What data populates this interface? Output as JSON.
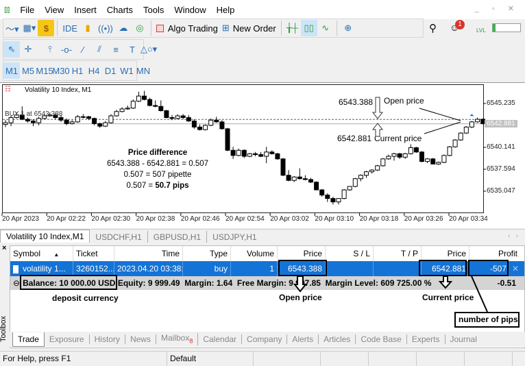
{
  "menu": {
    "items": [
      "File",
      "View",
      "Insert",
      "Charts",
      "Tools",
      "Window",
      "Help"
    ]
  },
  "toolbar": {
    "ide": "IDE",
    "algo_trading": "Algo Trading",
    "new_order": "New Order",
    "notification_count": "1",
    "level_label": "LVL"
  },
  "timeframes": [
    "M1",
    "M5",
    "M15",
    "M30",
    "H1",
    "H4",
    "D1",
    "W1",
    "MN"
  ],
  "timeframe_selected": "M1",
  "chart": {
    "title": "Volatility 10 Index, M1",
    "bid_label": "BUY 1 at 6543.388",
    "current_price_label": "6542.881",
    "annotations": {
      "open_value": "6543.388",
      "open_label": "Open price",
      "current_value": "6542.881",
      "current_label": "Current price",
      "diff_title": "Price difference",
      "diff_line1": "6543.388 - 6542.881 = 0.507",
      "diff_line2": "0.507 = 507 pipette",
      "diff_line3a": "0.507 = ",
      "diff_line3b": "50.7 pips"
    }
  },
  "chart_data": {
    "type": "candlestick",
    "title": "Volatility 10 Index, M1",
    "x_tick_labels": [
      "20 Apr 2023",
      "20 Apr 02:22",
      "20 Apr 02:30",
      "20 Apr 02:38",
      "20 Apr 02:46",
      "20 Apr 02:54",
      "20 Apr 03:02",
      "20 Apr 03:10",
      "20 Apr 03:18",
      "20 Apr 03:26",
      "20 Apr 03:34"
    ],
    "y_tick_labels": [
      "6545.235",
      "6540.141",
      "6537.594",
      "6535.047"
    ],
    "y_ticks": [
      6545.235,
      6540.141,
      6537.594,
      6535.047
    ],
    "ylim": [
      6532.9,
      6547.6
    ],
    "open_price_line": 6543.388,
    "current_price_line": 6542.881,
    "candles_ohlc": [
      [
        6542.8,
        6543.3,
        6542.5,
        6543.0
      ],
      [
        6543.0,
        6543.8,
        6542.6,
        6543.6
      ],
      [
        6543.6,
        6544.2,
        6543.5,
        6543.9
      ],
      [
        6543.9,
        6544.9,
        6543.3,
        6543.4
      ],
      [
        6543.4,
        6543.6,
        6543.0,
        6543.2
      ],
      [
        6543.2,
        6543.4,
        6542.6,
        6543.0
      ],
      [
        6543.0,
        6543.7,
        6542.7,
        6543.5
      ],
      [
        6543.5,
        6544.0,
        6543.4,
        6543.8
      ],
      [
        6543.8,
        6544.2,
        6543.7,
        6543.9
      ],
      [
        6543.9,
        6544.1,
        6543.4,
        6543.6
      ],
      [
        6543.6,
        6543.9,
        6543.1,
        6543.3
      ],
      [
        6543.3,
        6543.5,
        6542.7,
        6542.9
      ],
      [
        6542.9,
        6543.3,
        6542.8,
        6543.1
      ],
      [
        6543.1,
        6543.9,
        6543.0,
        6543.7
      ],
      [
        6543.7,
        6544.0,
        6543.5,
        6543.7
      ],
      [
        6543.7,
        6543.8,
        6543.3,
        6543.5
      ],
      [
        6543.5,
        6543.6,
        6542.7,
        6542.9
      ],
      [
        6542.9,
        6543.0,
        6542.4,
        6542.6
      ],
      [
        6542.6,
        6543.2,
        6542.5,
        6543.0
      ],
      [
        6543.0,
        6544.0,
        6542.9,
        6543.8
      ],
      [
        6543.8,
        6544.5,
        6543.7,
        6544.3
      ],
      [
        6544.3,
        6544.8,
        6544.2,
        6544.6
      ],
      [
        6544.6,
        6545.0,
        6544.5,
        6544.7
      ],
      [
        6544.7,
        6545.7,
        6544.6,
        6545.5
      ],
      [
        6545.5,
        6546.6,
        6545.4,
        6546.1
      ],
      [
        6546.1,
        6546.7,
        6545.6,
        6545.7
      ],
      [
        6545.7,
        6545.9,
        6544.9,
        6545.0
      ],
      [
        6545.0,
        6545.6,
        6544.8,
        6544.9
      ],
      [
        6544.9,
        6545.6,
        6544.3,
        6544.4
      ],
      [
        6544.4,
        6544.5,
        6543.5,
        6543.6
      ],
      [
        6543.6,
        6543.9,
        6543.3,
        6543.5
      ],
      [
        6543.5,
        6544.0,
        6543.4,
        6543.8
      ],
      [
        6543.8,
        6544.0,
        6543.4,
        6543.6
      ],
      [
        6543.6,
        6543.9,
        6543.1,
        6543.2
      ],
      [
        6543.2,
        6543.4,
        6542.3,
        6542.5
      ],
      [
        6542.5,
        6542.8,
        6542.1,
        6542.2
      ],
      [
        6542.2,
        6542.8,
        6542.1,
        6542.7
      ],
      [
        6542.7,
        6543.5,
        6542.6,
        6543.3
      ],
      [
        6543.3,
        6543.7,
        6543.0,
        6543.1
      ],
      [
        6543.1,
        6543.3,
        6542.2,
        6542.3
      ],
      [
        6542.3,
        6542.4,
        6539.7,
        6539.8
      ],
      [
        6539.8,
        6540.2,
        6538.8,
        6539.2
      ],
      [
        6539.2,
        6540.0,
        6539.1,
        6539.8
      ],
      [
        6539.8,
        6539.9,
        6538.9,
        6539.1
      ],
      [
        6539.1,
        6539.5,
        6539.0,
        6539.4
      ],
      [
        6539.4,
        6539.6,
        6539.1,
        6539.3
      ],
      [
        6539.3,
        6539.6,
        6539.0,
        6539.1
      ],
      [
        6539.1,
        6540.2,
        6538.3,
        6539.6
      ],
      [
        6539.6,
        6539.8,
        6539.3,
        6539.4
      ],
      [
        6539.4,
        6539.5,
        6538.7,
        6538.8
      ],
      [
        6538.8,
        6538.9,
        6536.8,
        6536.9
      ],
      [
        6536.9,
        6537.5,
        6536.2,
        6536.3
      ],
      [
        6536.3,
        6536.8,
        6536.1,
        6536.7
      ],
      [
        6536.7,
        6537.7,
        6536.4,
        6536.5
      ],
      [
        6536.5,
        6536.9,
        6536.3,
        6536.4
      ],
      [
        6536.4,
        6536.6,
        6536.0,
        6536.1
      ],
      [
        6536.1,
        6536.2,
        6535.2,
        6535.2
      ],
      [
        6535.2,
        6535.3,
        6534.4,
        6534.6
      ],
      [
        6534.6,
        6534.8,
        6533.8,
        6534.2
      ],
      [
        6534.2,
        6534.4,
        6533.5,
        6533.8
      ],
      [
        6533.8,
        6534.2,
        6533.5,
        6534.2
      ],
      [
        6534.2,
        6535.3,
        6534.1,
        6535.2
      ],
      [
        6535.2,
        6535.6,
        6535.1,
        6535.6
      ],
      [
        6535.6,
        6536.6,
        6535.5,
        6536.5
      ],
      [
        6536.5,
        6537.0,
        6536.2,
        6536.9
      ],
      [
        6536.9,
        6537.4,
        6536.6,
        6537.3
      ],
      [
        6537.3,
        6537.6,
        6537.1,
        6537.5
      ],
      [
        6537.5,
        6538.1,
        6537.4,
        6538.0
      ],
      [
        6538.0,
        6538.9,
        6537.9,
        6538.8
      ],
      [
        6538.8,
        6539.3,
        6538.7,
        6539.1
      ],
      [
        6539.1,
        6539.5,
        6538.6,
        6539.4
      ],
      [
        6539.4,
        6539.5,
        6538.8,
        6539.0
      ],
      [
        6539.0,
        6539.5,
        6538.8,
        6539.4
      ],
      [
        6539.4,
        6540.5,
        6539.3,
        6540.1
      ],
      [
        6540.1,
        6540.2,
        6539.5,
        6539.6
      ],
      [
        6539.6,
        6539.7,
        6538.4,
        6538.5
      ],
      [
        6538.5,
        6538.9,
        6538.3,
        6538.8
      ],
      [
        6538.8,
        6538.9,
        6538.2,
        6538.2
      ],
      [
        6538.2,
        6538.5,
        6538.1,
        6538.4
      ],
      [
        6538.4,
        6539.3,
        6538.3,
        6539.2
      ],
      [
        6539.2,
        6540.3,
        6539.1,
        6540.2
      ],
      [
        6540.2,
        6541.1,
        6540.1,
        6541.0
      ],
      [
        6541.0,
        6541.9,
        6540.9,
        6541.8
      ],
      [
        6541.8,
        6542.6,
        6541.7,
        6542.5
      ],
      [
        6542.5,
        6543.2,
        6542.4,
        6543.1
      ],
      [
        6543.1,
        6543.6,
        6543.0,
        6543.4
      ],
      [
        6543.4,
        6543.5,
        6542.8,
        6542.9
      ]
    ]
  },
  "chart_tabs": [
    "Volatility 10 Index,M1",
    "USDCHF,H1",
    "GBPUSD,H1",
    "USDJPY,H1"
  ],
  "trade": {
    "columns": [
      "Symbol",
      "Ticket",
      "Time",
      "Type",
      "Volume",
      "Price",
      "S / L",
      "T / P",
      "Price",
      "Profit"
    ],
    "row": {
      "symbol": "volatility 1...",
      "ticket": "3260152...",
      "time": "2023.04.20 03:38:...",
      "type": "buy",
      "volume": "1",
      "open_price": "6543.388",
      "sl": "",
      "tp": "",
      "current_price": "6542.881",
      "profit": "-507"
    },
    "balance": {
      "balance": "Balance: 10 000.00 USD",
      "equity": "Equity: 9 999.49",
      "margin": "Margin: 1.64",
      "free_margin": "Free Margin: 9 997.85",
      "margin_level": "Margin Level: 609 725.00 %",
      "profit": "-0.51"
    },
    "annotations": {
      "deposit": "deposit currency",
      "open": "Open price",
      "current": "Current price",
      "pips": "number of pips"
    }
  },
  "toolbox_label": "Toolbox",
  "bottom_tabs": [
    "Trade",
    "Exposure",
    "History",
    "News",
    "Mailbox",
    "Calendar",
    "Company",
    "Alerts",
    "Articles",
    "Code Base",
    "Experts",
    "Journal"
  ],
  "mailbox_count": "8",
  "status": {
    "help": "For Help, press F1",
    "profile": "Default"
  },
  "colors": {
    "selected_row": "#1473d6",
    "bull": "#ffffff",
    "bear": "#000000",
    "open_line": "#2e7d4f"
  }
}
